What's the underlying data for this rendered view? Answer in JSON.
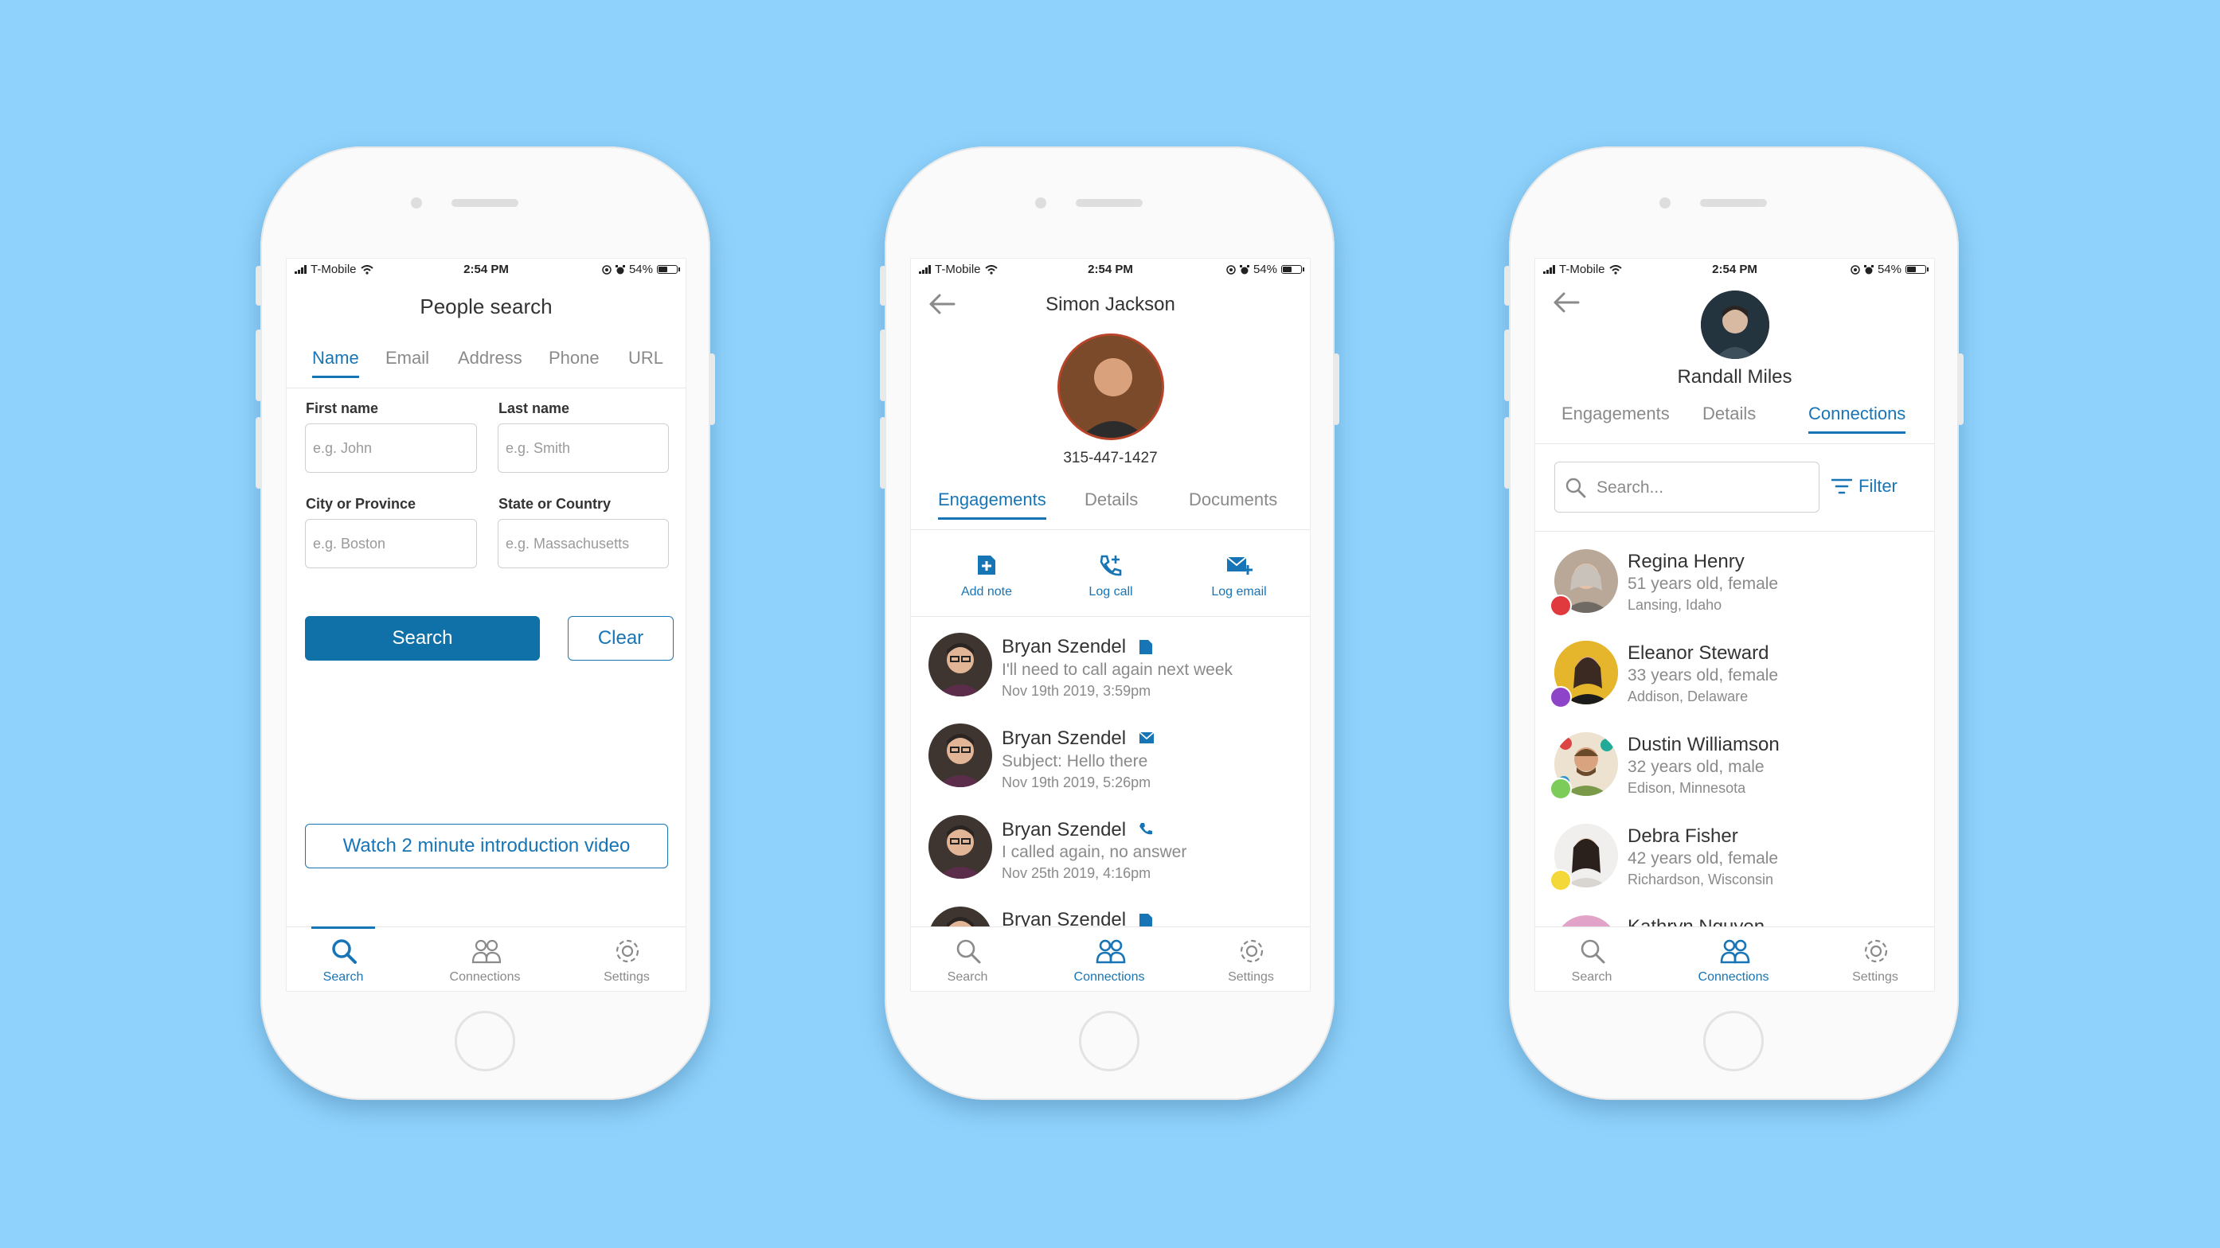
{
  "status": {
    "carrier": "T-Mobile",
    "time": "2:54 PM",
    "battery": "54%"
  },
  "screen1": {
    "title": "People search",
    "tabs": [
      {
        "label": "Name",
        "active": true
      },
      {
        "label": "Email",
        "active": false
      },
      {
        "label": "Address",
        "active": false
      },
      {
        "label": "Phone",
        "active": false
      },
      {
        "label": "URL",
        "active": false
      }
    ],
    "fields": {
      "first_name": {
        "label": "First name",
        "placeholder": "e.g. John"
      },
      "last_name": {
        "label": "Last name",
        "placeholder": "e.g. Smith"
      },
      "city": {
        "label": "City or Province",
        "placeholder": "e.g. Boston"
      },
      "state": {
        "label": "State or Country",
        "placeholder": "e.g. Massachusetts"
      }
    },
    "search_button": "Search",
    "clear_button": "Clear",
    "video_button": "Watch 2 minute introduction video"
  },
  "nav": {
    "search": "Search",
    "connections": "Connections",
    "settings": "Settings"
  },
  "screen2": {
    "name": "Simon Jackson",
    "phone": "315-447-1427",
    "tabs": [
      {
        "label": "Engagements",
        "active": true
      },
      {
        "label": "Details",
        "active": false
      },
      {
        "label": "Documents",
        "active": false
      }
    ],
    "actions": {
      "add_note": "Add note",
      "log_call": "Log call",
      "log_email": "Log email"
    },
    "engagements": [
      {
        "name": "Bryan Szendel",
        "type": "note-icon",
        "text": "I'll need to call again next week",
        "date": "Nov 19th 2019, 3:59pm"
      },
      {
        "name": "Bryan Szendel",
        "type": "email-icon",
        "text": "Subject: Hello there",
        "date": "Nov 19th 2019, 5:26pm"
      },
      {
        "name": "Bryan Szendel",
        "type": "phone-icon",
        "text": "I called again, no answer",
        "date": "Nov 25th 2019, 4:16pm"
      },
      {
        "name": "Bryan Szendel",
        "type": "note-icon",
        "text": "",
        "date": ""
      }
    ]
  },
  "screen3": {
    "name": "Randall Miles",
    "tabs": [
      {
        "label": "Engagements",
        "active": false
      },
      {
        "label": "Details",
        "active": false
      },
      {
        "label": "Connections",
        "active": true
      }
    ],
    "search_placeholder": "Search...",
    "filter_label": "Filter",
    "connections": [
      {
        "name": "Regina Henry",
        "meta": "51 years old, female",
        "location": "Lansing, Idaho",
        "dot": "#e0393e"
      },
      {
        "name": "Eleanor Steward",
        "meta": "33 years old, female",
        "location": "Addison, Delaware",
        "dot": "#8e44c9"
      },
      {
        "name": "Dustin Williamson",
        "meta": "32 years old, male",
        "location": "Edison, Minnesota",
        "dot": "#7ccc5a"
      },
      {
        "name": "Debra Fisher",
        "meta": "42 years old, female",
        "location": "Richardson, Wisconsin",
        "dot": "#f4d83a"
      },
      {
        "name": "Kathryn Nguyen",
        "meta": "",
        "location": "",
        "dot": "#e2a3c9"
      }
    ]
  },
  "colors": {
    "accent": "#1875b5",
    "button": "#1070a8",
    "background": "#8fd3fd"
  }
}
